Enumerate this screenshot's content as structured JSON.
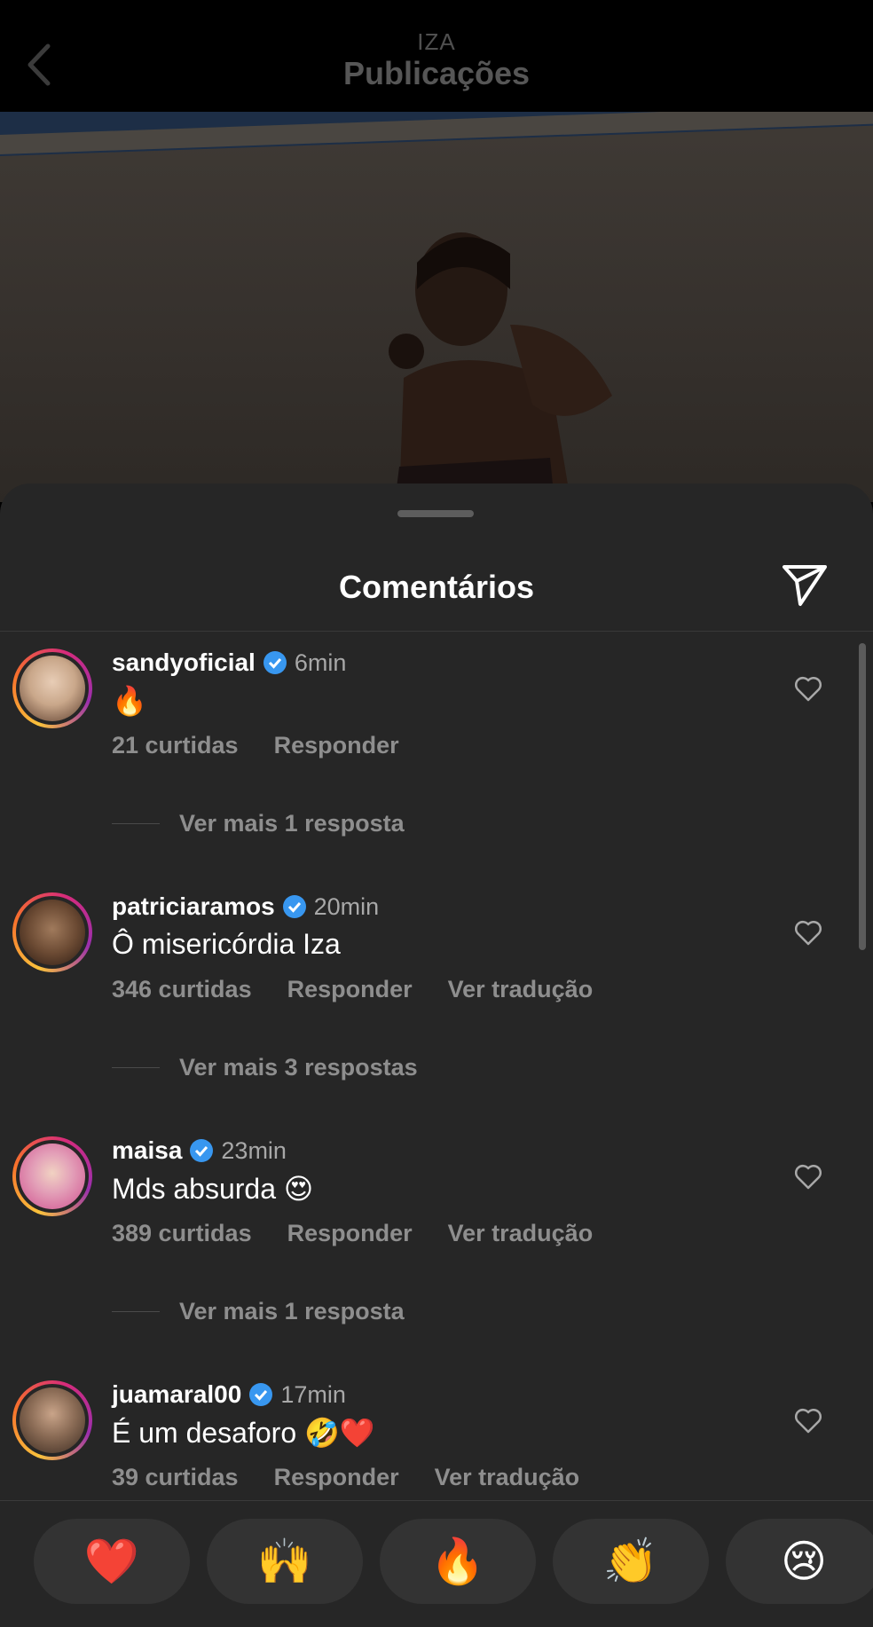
{
  "header": {
    "account": "IZA",
    "title": "Publicações"
  },
  "sheet": {
    "title": "Comentários"
  },
  "comments": [
    {
      "username": "sandyoficial",
      "time": "6min",
      "text": "🔥",
      "likes": "21 curtidas",
      "reply": "Responder",
      "translate": "",
      "more": "Ver mais 1 resposta",
      "avatar_color": "#c9a78a"
    },
    {
      "username": "patriciaramos",
      "time": "20min",
      "text": "Ô misericórdia Iza",
      "likes": "346 curtidas",
      "reply": "Responder",
      "translate": "Ver tradução",
      "more": "Ver mais 3 respostas",
      "avatar_color": "#7a5a44"
    },
    {
      "username": "maisa",
      "time": "23min",
      "text": "Mds absurda 😍",
      "likes": "389 curtidas",
      "reply": "Responder",
      "translate": "Ver tradução",
      "more": "Ver mais 1 resposta",
      "avatar_color": "#e070a8"
    },
    {
      "username": "juamaral00",
      "time": "17min",
      "text": "É um desaforo 🤣❤️",
      "likes": "39 curtidas",
      "reply": "Responder",
      "translate": "Ver tradução",
      "more": "",
      "avatar_color": "#8a6b55"
    }
  ],
  "reactions": [
    "❤️",
    "🙌",
    "🔥",
    "👏",
    "😢"
  ],
  "colors": {
    "background": "#262626",
    "verified": "#3897f0",
    "muted": "#8e8e8e"
  }
}
